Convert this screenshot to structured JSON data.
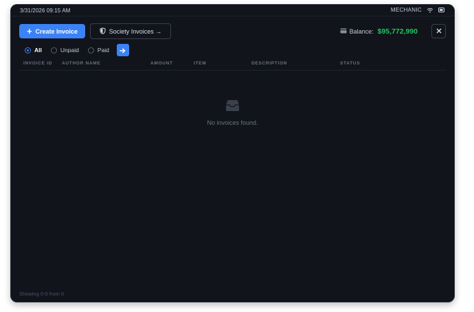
{
  "statusbar": {
    "datetime": "3/31/2026 09:15 AM",
    "job": "MECHANIC"
  },
  "toolbar": {
    "create_label": "Create Invoice",
    "society_label": "Society Invoices →",
    "balance_label": "Balance:",
    "balance_amount": "$95,772,990"
  },
  "filters": {
    "options": [
      "All",
      "Unpaid",
      "Paid"
    ],
    "selected": "All"
  },
  "table": {
    "columns": [
      "INVOICE ID",
      "AUTHOR NAME",
      "AMOUNT",
      "ITEM",
      "DESCRIPTION",
      "STATUS"
    ],
    "rows": []
  },
  "empty_state": {
    "message": "No invoices found."
  },
  "footer": {
    "pagination": "Showing 0-0 from 0"
  },
  "colors": {
    "accent": "#3b82f6",
    "balance": "#22c55e",
    "background": "#11141b"
  }
}
